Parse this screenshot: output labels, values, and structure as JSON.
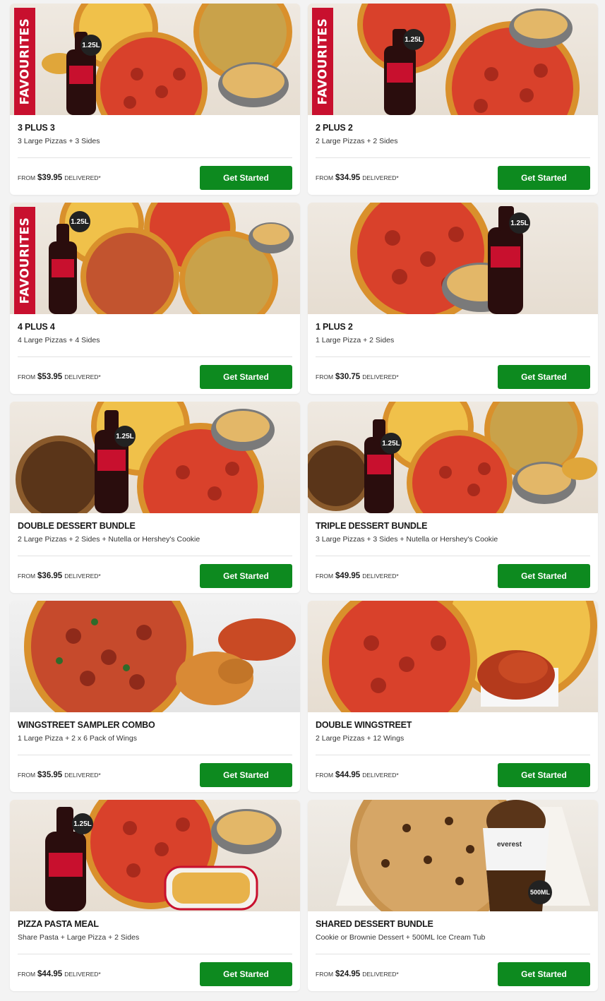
{
  "favourite_label": "FAVOURITES",
  "from_label": "FROM",
  "delivered_label": "DELIVERED*",
  "button_label": "Get Started",
  "bottle_size": "1.25L",
  "tub_size": "500ML",
  "ice_cream_brand": "everest",
  "colors": {
    "button": "#0d8a1f",
    "favourite": "#c8102e"
  },
  "deals": [
    {
      "title": "3 PLUS 3",
      "desc": "3 Large Pizzas + 3 Sides",
      "price": "$39.95",
      "favourite": true
    },
    {
      "title": "2 PLUS 2",
      "desc": "2 Large Pizzas + 2 Sides",
      "price": "$34.95",
      "favourite": true
    },
    {
      "title": "4 PLUS 4",
      "desc": "4 Large Pizzas + 4 Sides",
      "price": "$53.95",
      "favourite": true
    },
    {
      "title": "1 PLUS 2",
      "desc": "1 Large Pizza + 2 Sides",
      "price": "$30.75",
      "favourite": false
    },
    {
      "title": "DOUBLE DESSERT BUNDLE",
      "desc": "2 Large Pizzas + 2 Sides + Nutella or Hershey's Cookie",
      "price": "$36.95",
      "favourite": false
    },
    {
      "title": "TRIPLE DESSERT BUNDLE",
      "desc": "3 Large Pizzas + 3 Sides + Nutella or Hershey's Cookie",
      "price": "$49.95",
      "favourite": false
    },
    {
      "title": "WINGSTREET SAMPLER COMBO",
      "desc": "1 Large Pizza + 2 x 6 Pack of Wings",
      "price": "$35.95",
      "favourite": false
    },
    {
      "title": "DOUBLE WINGSTREET",
      "desc": "2 Large Pizzas + 12 Wings",
      "price": "$44.95",
      "favourite": false
    },
    {
      "title": "PIZZA PASTA MEAL",
      "desc": "Share Pasta + Large Pizza + 2 Sides",
      "price": "$44.95",
      "favourite": false
    },
    {
      "title": "SHARED DESSERT BUNDLE",
      "desc": "Cookie or Brownie Dessert + 500ML Ice Cream Tub",
      "price": "$24.95",
      "favourite": false
    }
  ]
}
